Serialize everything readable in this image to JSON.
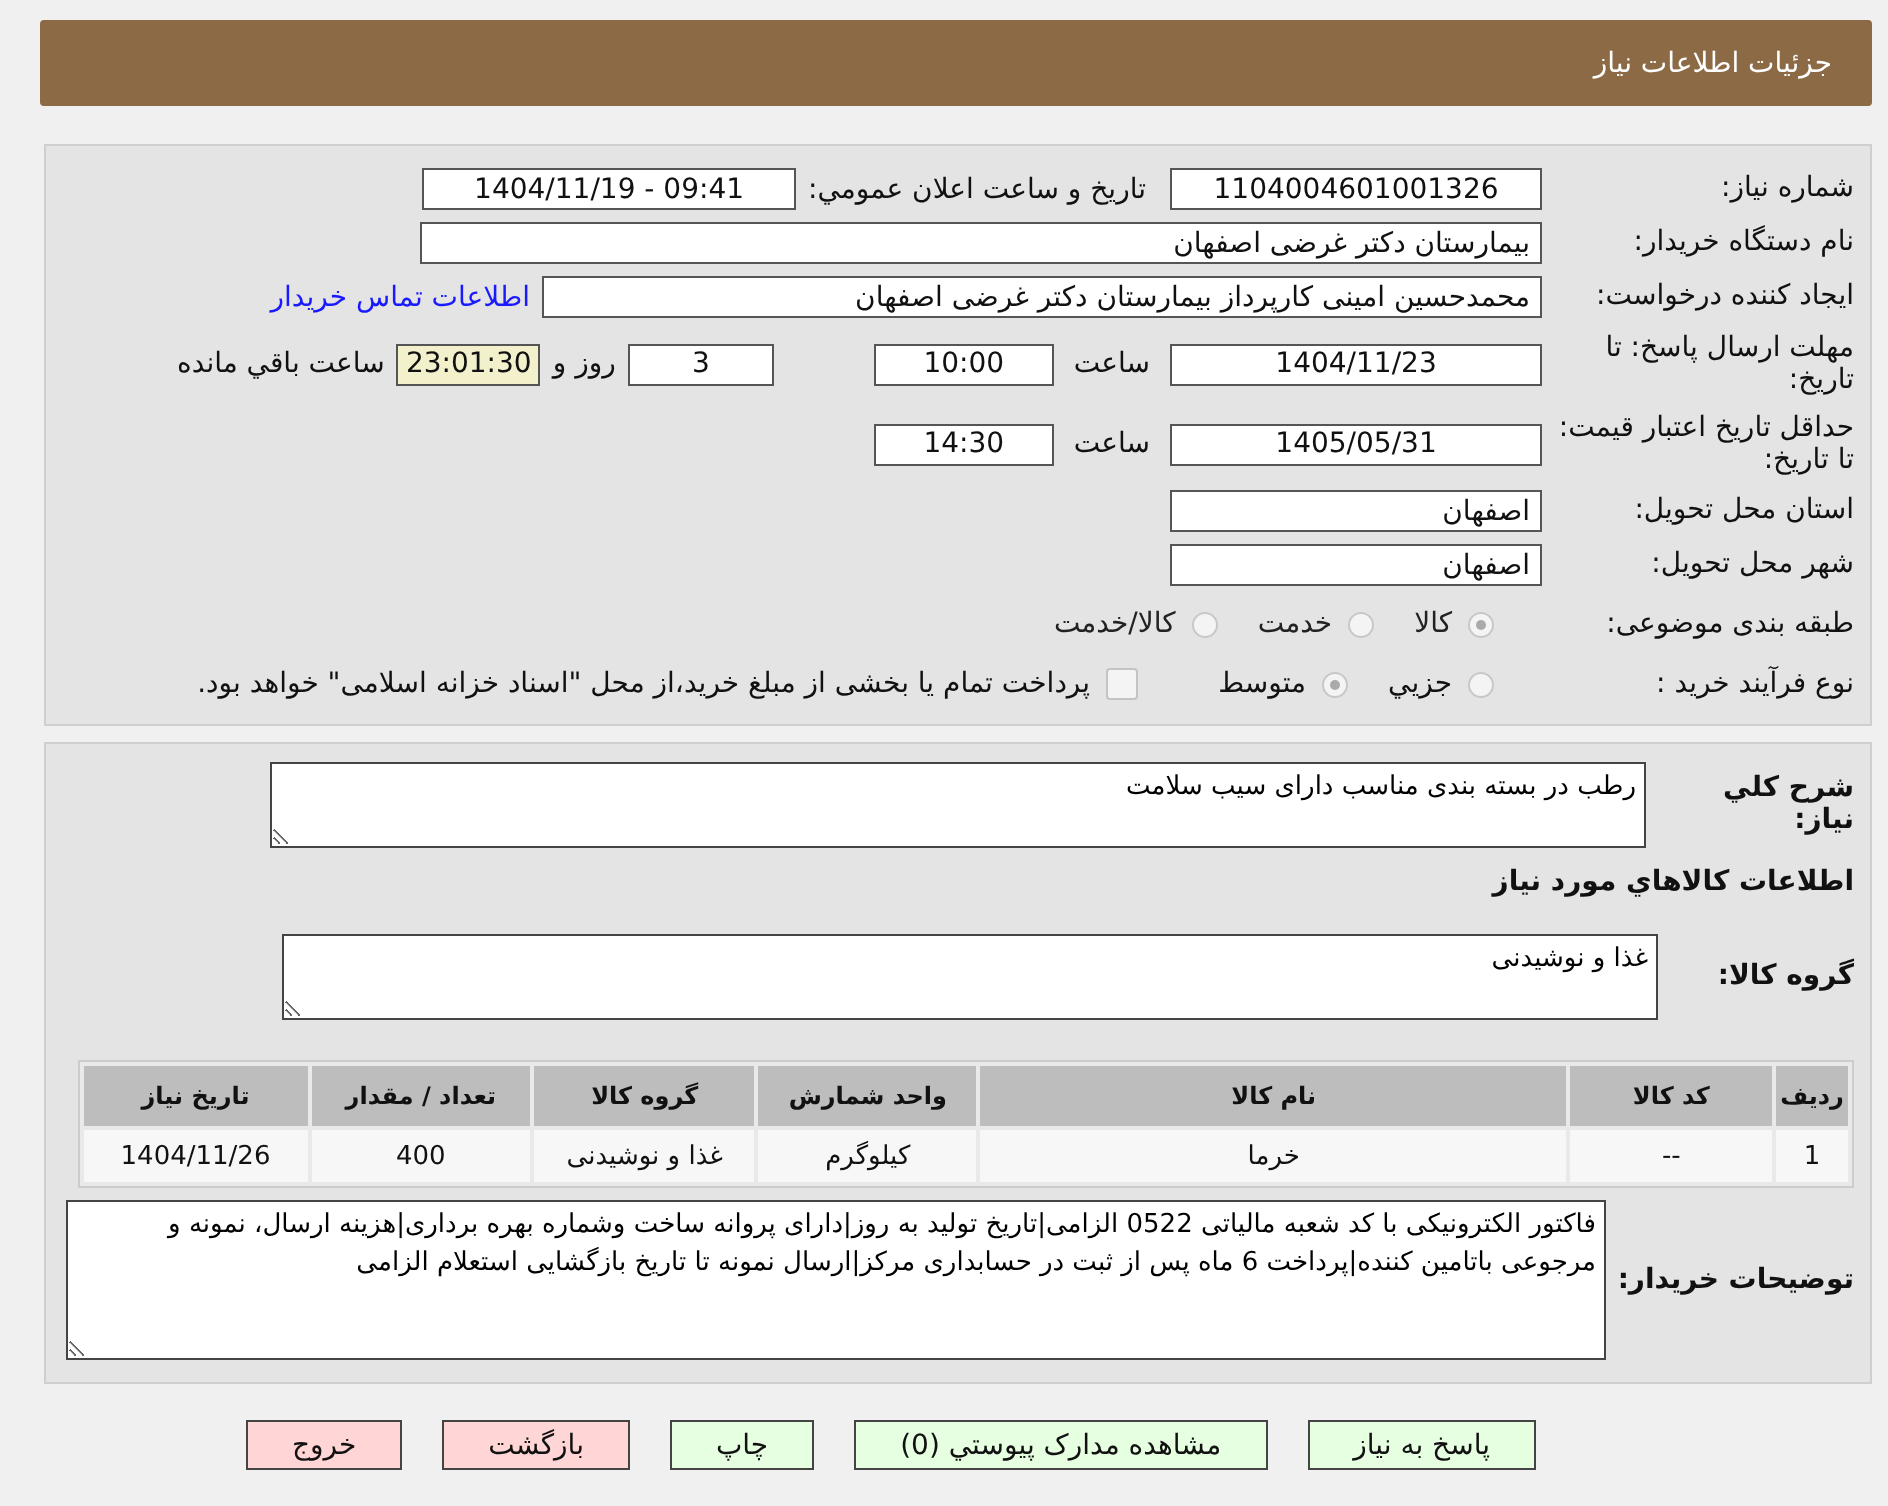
{
  "header": {
    "title": "جزئیات اطلاعات نیاز"
  },
  "need_number": {
    "label": "شماره نیاز:",
    "value": "1104004601001326"
  },
  "announce": {
    "label": "تاریخ و ساعت اعلان عمومي:",
    "value": "1404/11/19 - 09:41"
  },
  "buyer": {
    "label": "نام دستگاه خریدار:",
    "value": "بیمارستان دکتر غرضی اصفهان"
  },
  "requester": {
    "label": "ایجاد کننده درخواست:",
    "value": "محمدحسین امینی کارپرداز بیمارستان دکتر غرضی اصفهان",
    "link": "اطلاعات تماس خریدار"
  },
  "deadline": {
    "label": "مهلت ارسال پاسخ: تا تاریخ:",
    "date": "1404/11/23",
    "time_label": "ساعت",
    "time": "10:00",
    "days": "3",
    "days_label": "روز و",
    "remaining": "23:01:30",
    "remaining_label": "ساعت باقي مانده"
  },
  "validity": {
    "label": "حداقل تاریخ اعتبار قیمت: تا تاریخ:",
    "date": "1405/05/31",
    "time_label": "ساعت",
    "time": "14:30"
  },
  "province": {
    "label": "استان محل تحویل:",
    "value": "اصفهان"
  },
  "city": {
    "label": "شهر محل تحویل:",
    "value": "اصفهان"
  },
  "category": {
    "label": "طبقه بندی موضوعی:",
    "options": [
      {
        "label": "کالا",
        "selected": true
      },
      {
        "label": "خدمت",
        "selected": false
      },
      {
        "label": "کالا/خدمت",
        "selected": false
      }
    ]
  },
  "purchase_type": {
    "label": "نوع فرآیند خرید :",
    "options": [
      {
        "label": "جزيي",
        "selected": false
      },
      {
        "label": "متوسط",
        "selected": true
      }
    ],
    "payment_note": {
      "label": "پرداخت تمام یا بخشی از مبلغ خرید،از محل \"اسناد خزانه اسلامی\" خواهد بود.",
      "checked": false
    }
  },
  "description": {
    "label": "شرح کلي نیاز:",
    "value": "رطب در بسته بندی مناسب دارای سیب سلامت"
  },
  "goods_title": "اطلاعات کالاهاي مورد نیاز",
  "goods_group": {
    "label": "گروه کالا:",
    "value": "غذا و نوشیدنی"
  },
  "table": {
    "columns": [
      "ردیف",
      "کد کالا",
      "نام کالا",
      "واحد شمارش",
      "گروه کالا",
      "تعداد / مقدار",
      "تاریخ نیاز"
    ],
    "rows": [
      [
        "1",
        "--",
        "خرما",
        "کیلوگرم",
        "غذا و نوشیدنی",
        "400",
        "1404/11/26"
      ]
    ]
  },
  "buyer_notes": {
    "label": "توضیحات خریدار:",
    "value": "فاکتور الکترونیکی با کد شعبه مالیاتی 0522 الزامی|تاریخ تولید به روز|دارای پروانه ساخت وشماره بهره برداری|هزینه ارسال، نمونه و مرجوعی باتامین کننده|پرداخت 6 ماه پس از ثبت در حسابداری مرکز|ارسال نمونه تا تاریخ بازگشایی استعلام الزامی"
  },
  "buttons": [
    {
      "label": "پاسخ به نیاز",
      "kind": "go"
    },
    {
      "label": "مشاهده مدارک پیوستي (0)",
      "kind": "go"
    },
    {
      "label": "چاپ",
      "kind": "go"
    },
    {
      "label": "بازگشت",
      "kind": "stop"
    },
    {
      "label": "خروج",
      "kind": "stop"
    }
  ]
}
